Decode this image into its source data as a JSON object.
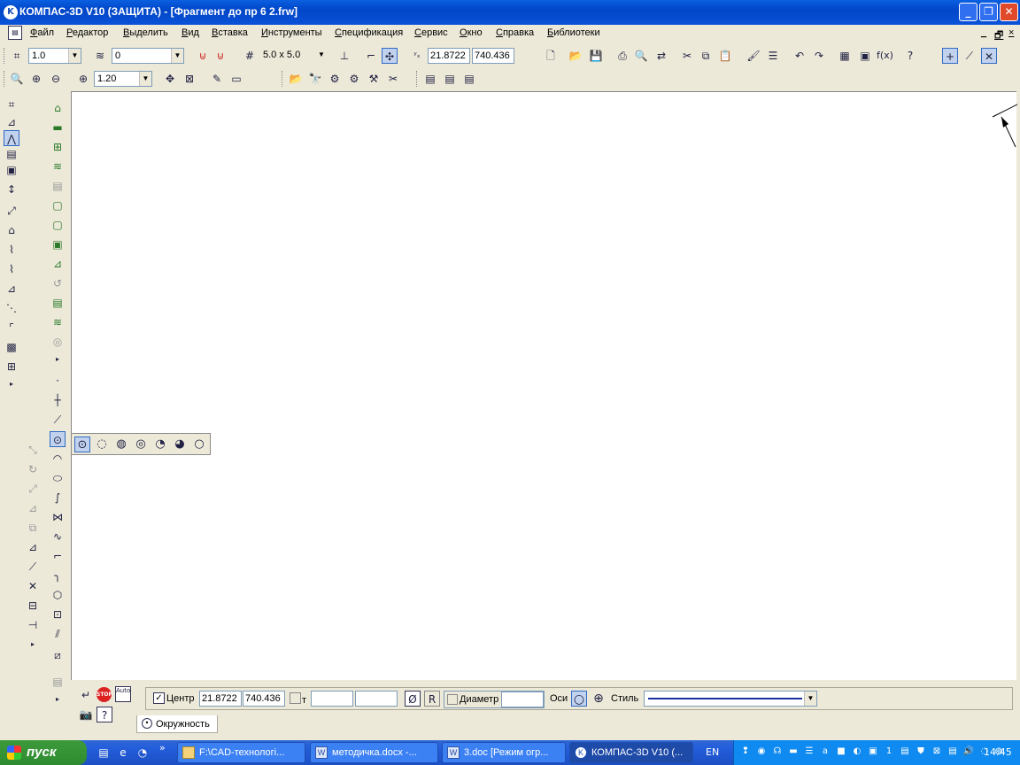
{
  "window": {
    "title": "КОМПАС-3D V10 (ЗАЩИТА) - [Фрагмент до пр 6  2.frw]",
    "min_icon": "minimize-icon",
    "max_icon": "restore-icon",
    "close_icon": "close-icon"
  },
  "menu": [
    "Файл",
    "Редактор",
    "Выделить",
    "Вид",
    "Вставка",
    "Инструменты",
    "Спецификация",
    "Сервис",
    "Окно",
    "Справка",
    "Библиотеки"
  ],
  "mdi_controls": [
    "_",
    "🗗",
    "×"
  ],
  "toolbar1": {
    "step_value": "1.0",
    "layer_value": "0",
    "grid_value": "5.0 x 5.0",
    "coord_x": "21.8722",
    "coord_y": "740.436"
  },
  "toolbar2": {
    "zoom_value": "1.20"
  },
  "property_bar": {
    "center_label": "Центр",
    "center_x": "21.8722",
    "center_y": "740.436",
    "point_label": "т",
    "diameter_symbol": "Ø",
    "radius_label": "R",
    "diameter_label": "Диаметр",
    "axes_label": "Оси",
    "style_label": "Стиль",
    "stop_label": "STOP",
    "auto_label": "Auto",
    "tab_label": "Окружность"
  },
  "taskbar": {
    "start_label": "пуск",
    "buttons": [
      "F:\\CAD-технологі...",
      "методичка.docx -...",
      "3.doc [Режим огр...",
      "КОМПАС-3D V10 (..."
    ],
    "lang": "EN",
    "clock": "14:45"
  },
  "colors": {
    "title_blue": "#0046c8",
    "face": "#ece9d8",
    "taskbar_blue": "#245edb",
    "style_line": "#1a2fa0"
  }
}
